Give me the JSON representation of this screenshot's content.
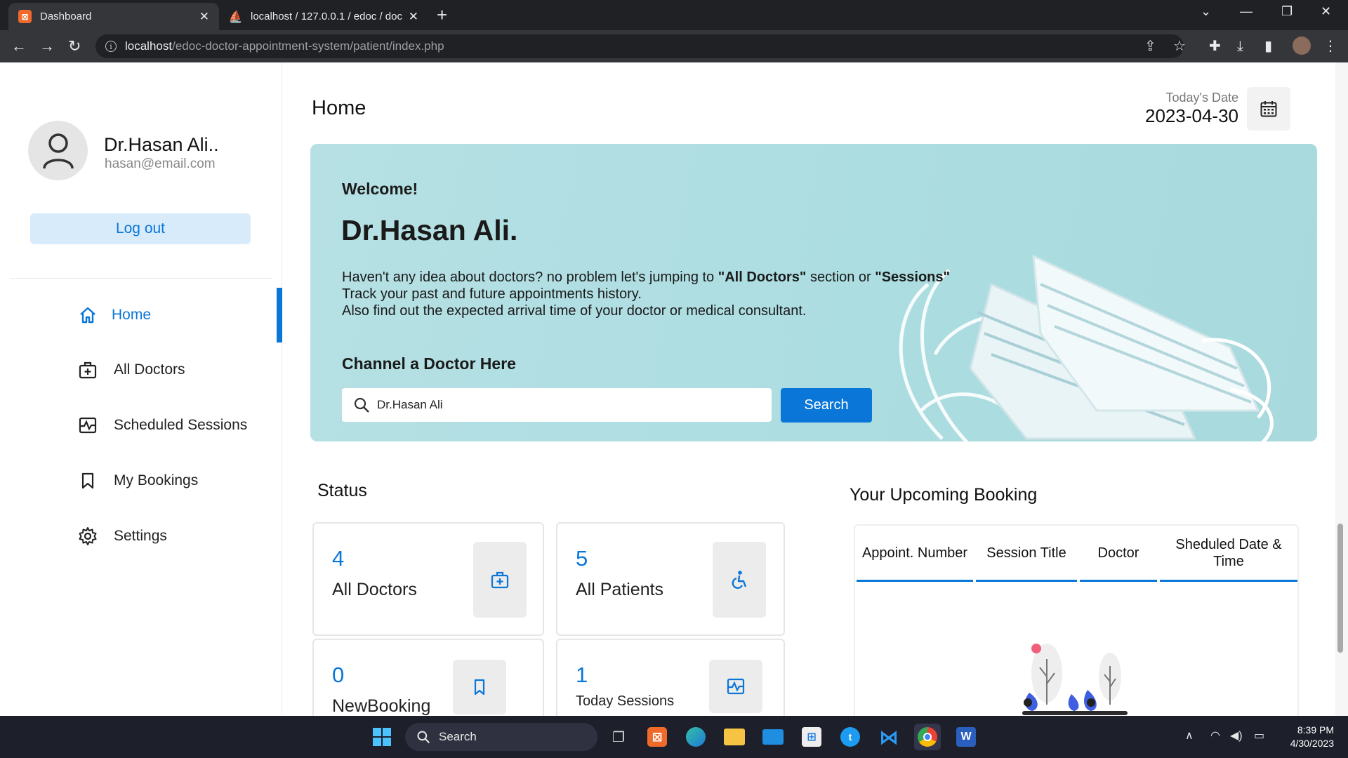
{
  "browser": {
    "tabs": [
      {
        "title": "Dashboard",
        "active": true
      },
      {
        "title": "localhost / 127.0.0.1 / edoc / doc",
        "active": false
      }
    ],
    "url_host": "localhost",
    "url_path": "/edoc-doctor-appointment-system/patient/index.php"
  },
  "profile": {
    "name": "Dr.Hasan Ali..",
    "email": "hasan@email.com",
    "logout_label": "Log out"
  },
  "menu": [
    {
      "label": "Home",
      "icon": "home-icon",
      "active": true
    },
    {
      "label": "All Doctors",
      "icon": "doctor-bag-icon",
      "active": false
    },
    {
      "label": "Scheduled Sessions",
      "icon": "sessions-icon",
      "active": false
    },
    {
      "label": "My Bookings",
      "icon": "bookmark-icon",
      "active": false
    },
    {
      "label": "Settings",
      "icon": "gear-icon",
      "active": false
    }
  ],
  "header": {
    "title": "Home",
    "date_label": "Today's Date",
    "date_value": "2023-04-30"
  },
  "hero": {
    "welcome": "Welcome!",
    "name": "Dr.Hasan Ali.",
    "line1_a": "Haven't any idea about doctors? no problem let's jumping to ",
    "line1_b": "\"All Doctors\"",
    "line1_c": " section or ",
    "line1_d": "\"Sessions\"",
    "line2": "Track your past and future appointments history.",
    "line3": "Also find out the expected arrival time of your doctor or medical consultant.",
    "channel_title": "Channel a Doctor Here",
    "search_value": "Dr.Hasan Ali",
    "search_button": "Search"
  },
  "status": {
    "title": "Status",
    "cards": [
      {
        "value": "4",
        "label": "All Doctors",
        "icon": "doctor-bag-icon"
      },
      {
        "value": "5",
        "label": "All Patients",
        "icon": "accessible-icon"
      },
      {
        "value": "0",
        "label": "NewBooking",
        "icon": "bookmark-icon"
      },
      {
        "value": "1",
        "label": "Today Sessions",
        "icon": "sessions-icon"
      }
    ]
  },
  "upcoming": {
    "title": "Your Upcoming Booking",
    "columns": [
      "Appoint. Number",
      "Session Title",
      "Doctor",
      "Sheduled Date & Time"
    ]
  },
  "taskbar": {
    "search_label": "Search",
    "time": "8:39 PM",
    "date": "4/30/2023"
  },
  "colors": {
    "accent": "#0a76d8",
    "hero_bg": "#acdde1",
    "logout_bg": "#d8ebfa"
  }
}
